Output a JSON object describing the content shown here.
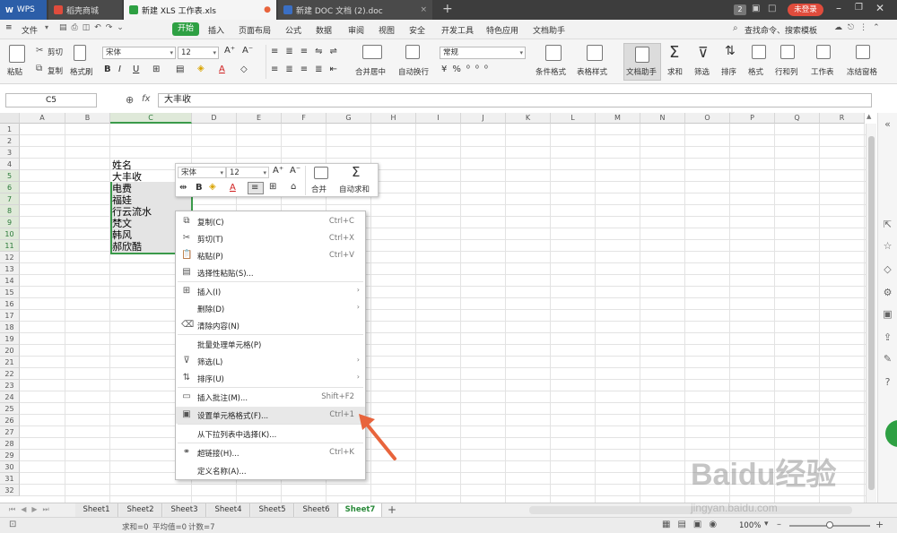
{
  "titlebar": {
    "tabs": [
      {
        "label": "WPS",
        "icon": "wps-logo-icon"
      },
      {
        "label": "稻壳商城",
        "icon": "docer-icon"
      },
      {
        "label": "新建 XLS 工作表.xls",
        "icon": "xls-icon"
      },
      {
        "label": "新建 DOC 文档 (2).doc",
        "icon": "doc-icon"
      }
    ],
    "badge": "2",
    "login": "未登录"
  },
  "menubar": {
    "file": "文件",
    "start": "开始",
    "items": [
      "插入",
      "页面布局",
      "公式",
      "数据",
      "审阅",
      "视图",
      "安全",
      "开发工具",
      "特色应用",
      "文档助手"
    ],
    "search": "查找命令、搜索模板"
  },
  "ribbon": {
    "paste": "粘贴",
    "cut": "剪切",
    "copy": "复制",
    "format_painter": "格式刷",
    "font_name": "宋体",
    "font_size": "12",
    "merge": "合并居中",
    "wrap": "自动换行",
    "number_format": "常规",
    "cond_format": "条件格式",
    "table_style": "表格样式",
    "doc_helper": "文档助手",
    "sum": "求和",
    "filter": "筛选",
    "sort": "排序",
    "format": "格式",
    "rowcol": "行和列",
    "worksheet": "工作表",
    "freeze": "冻结窗格"
  },
  "formula_bar": {
    "name_box": "C5",
    "fx": "fx",
    "value": "大丰收"
  },
  "columns": [
    "A",
    "B",
    "C",
    "D",
    "E",
    "F",
    "G",
    "H",
    "I",
    "J",
    "K",
    "L",
    "M",
    "N",
    "O",
    "P",
    "Q",
    "R"
  ],
  "rows": [
    "1",
    "2",
    "3",
    "4",
    "5",
    "6",
    "7",
    "8",
    "9",
    "10",
    "11",
    "12",
    "13",
    "14",
    "15",
    "16",
    "17",
    "18",
    "19",
    "20",
    "21",
    "22",
    "23",
    "24",
    "25",
    "26",
    "27",
    "28",
    "29",
    "30",
    "31",
    "32"
  ],
  "cells": {
    "c4": "姓名",
    "c5": "大丰收",
    "c6": "电费",
    "c7": "福娃",
    "c8": "行云流水",
    "c9": "梵文",
    "c10": "韩风",
    "c11": "郝欣酷"
  },
  "mini_toolbar": {
    "font_name": "宋体",
    "font_size": "12",
    "merge": "合并",
    "autosum": "自动求和"
  },
  "context_menu": [
    {
      "label": "复制(C)",
      "shortcut": "Ctrl+C",
      "icon": "copy-icon"
    },
    {
      "label": "剪切(T)",
      "shortcut": "Ctrl+X",
      "icon": "scissors-icon"
    },
    {
      "label": "粘贴(P)",
      "shortcut": "Ctrl+V",
      "icon": "paste-icon"
    },
    {
      "label": "选择性粘贴(S)...",
      "shortcut": "",
      "icon": "paste-special-icon"
    },
    {
      "label": "插入(I)",
      "shortcut": "",
      "icon": "insert-icon",
      "submenu": true
    },
    {
      "label": "删除(D)",
      "shortcut": "",
      "icon": "",
      "submenu": true
    },
    {
      "label": "清除内容(N)",
      "shortcut": "",
      "icon": "eraser-icon"
    },
    {
      "label": "批量处理单元格(P)",
      "shortcut": "",
      "icon": ""
    },
    {
      "label": "筛选(L)",
      "shortcut": "",
      "icon": "filter-icon",
      "submenu": true
    },
    {
      "label": "排序(U)",
      "shortcut": "",
      "icon": "sort-icon",
      "submenu": true
    },
    {
      "label": "插入批注(M)...",
      "shortcut": "Shift+F2",
      "icon": "comment-icon"
    },
    {
      "label": "设置单元格格式(F)...",
      "shortcut": "Ctrl+1",
      "icon": "format-cells-icon",
      "highlighted": true
    },
    {
      "label": "从下拉列表中选择(K)...",
      "shortcut": "",
      "icon": ""
    },
    {
      "label": "超链接(H)...",
      "shortcut": "Ctrl+K",
      "icon": "link-icon"
    },
    {
      "label": "定义名称(A)...",
      "shortcut": "",
      "icon": ""
    }
  ],
  "sheets": [
    "Sheet1",
    "Sheet2",
    "Sheet3",
    "Sheet4",
    "Sheet5",
    "Sheet6",
    "Sheet7"
  ],
  "active_sheet": "Sheet7",
  "status": {
    "sum": "求和=0",
    "avg": "平均值=0",
    "count": "计数=7",
    "zoom": "100%"
  },
  "watermark": {
    "main": "Baidu经验",
    "sub": "jingyan.baidu.com"
  },
  "colors": {
    "accent_green": "#2ea043",
    "selection_green": "#3a9a4a",
    "arrow": "#e8643c",
    "titlebar": "#3d3d3d",
    "login_red": "#e04c3c"
  }
}
